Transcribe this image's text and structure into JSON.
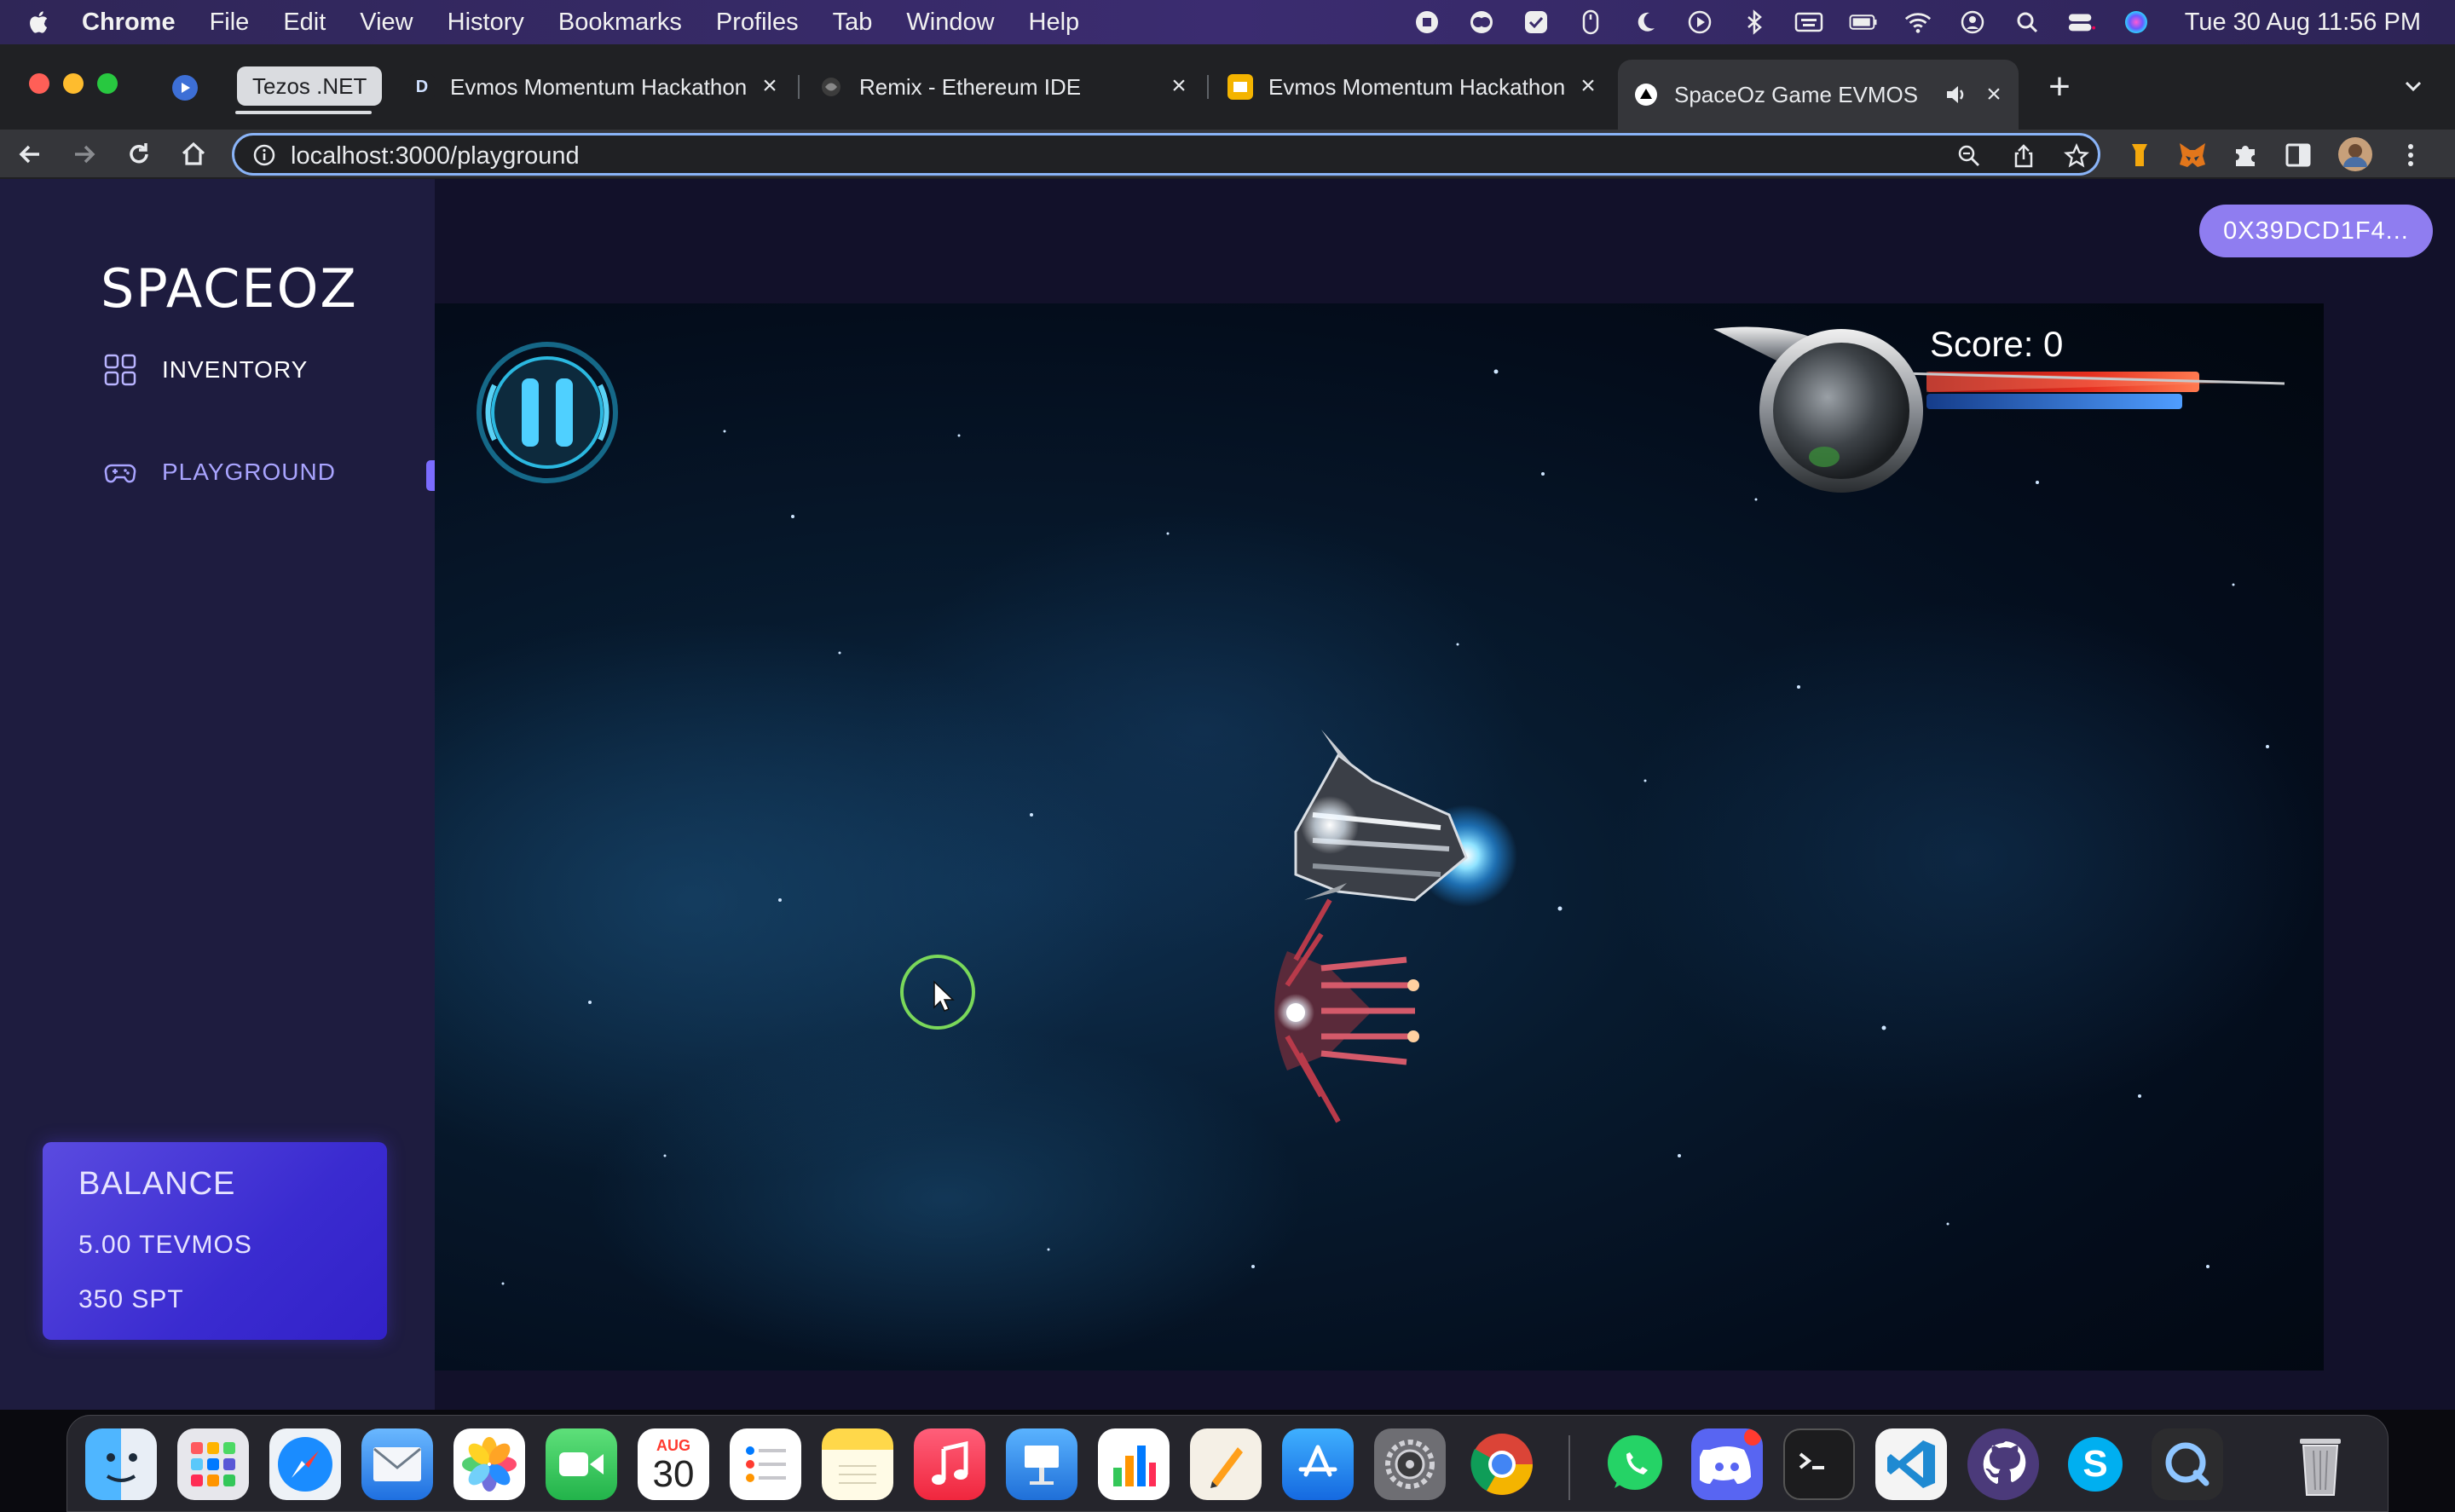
{
  "menubar": {
    "app_name": "Chrome",
    "items": [
      "File",
      "Edit",
      "View",
      "History",
      "Bookmarks",
      "Profiles",
      "Tab",
      "Window",
      "Help"
    ],
    "clock": "Tue 30 Aug  11:56 PM"
  },
  "tabs": {
    "group_label": "Tezos .NET",
    "items": [
      {
        "title": "Evmos Momentum Hackathon",
        "icon": "devpost-icon"
      },
      {
        "title": "Remix - Ethereum IDE",
        "icon": "remix-icon"
      },
      {
        "title": "Evmos Momentum Hackathon",
        "icon": "slides-icon"
      },
      {
        "title": "SpaceOz Game EVMOS",
        "icon": "vercel-icon"
      }
    ]
  },
  "address_bar": {
    "url": "localhost:3000/playground"
  },
  "sidebar": {
    "logo": "SPACEOZ",
    "nav": [
      {
        "label": "INVENTORY",
        "icon": "grid-icon"
      },
      {
        "label": "PLAYGROUND",
        "icon": "gamepad-icon"
      }
    ],
    "balance": {
      "title": "BALANCE",
      "tevmos": "5.00 TEVMOS",
      "spt": "350 SPT"
    }
  },
  "wallet": {
    "address": "0X39DCD1F4..."
  },
  "game": {
    "score_text": "Score: 0"
  },
  "dock": {
    "calendar_month": "AUG",
    "calendar_day": "30"
  },
  "colors": {
    "accent": "#8f7df0",
    "sidebar_bg": "#1e1c3f",
    "page_bg": "#12112a",
    "balance_card": "#4b3ddb",
    "omnibox_focus": "#8ab4f8"
  }
}
